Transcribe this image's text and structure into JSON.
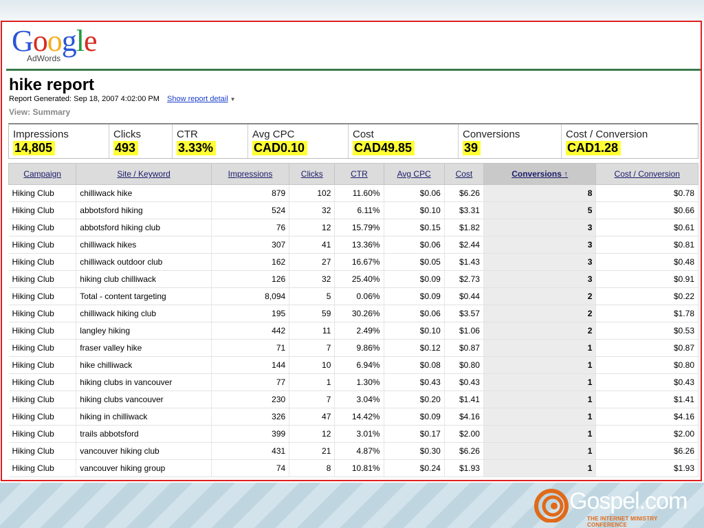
{
  "logo": {
    "letters": [
      "G",
      "o",
      "o",
      "g",
      "l",
      "e"
    ],
    "colors": [
      "#2a55d4",
      "#d62d20",
      "#f2b01e",
      "#2a55d4",
      "#1e9a3c",
      "#d62d20"
    ],
    "sub": "AdWords"
  },
  "report": {
    "title": "hike report",
    "generated": "Report Generated: Sep 18, 2007 4:02:00 PM",
    "detail_link": "Show report detail",
    "view": "View: Summary"
  },
  "stats": [
    {
      "label": "Impressions",
      "value": "14,805"
    },
    {
      "label": "Clicks",
      "value": "493"
    },
    {
      "label": "CTR",
      "value": "3.33%"
    },
    {
      "label": "Avg CPC",
      "value": "CAD0.10"
    },
    {
      "label": "Cost",
      "value": "CAD49.85"
    },
    {
      "label": "Conversions",
      "value": "39"
    },
    {
      "label": "Cost / Conversion",
      "value": "CAD1.28"
    }
  ],
  "table": {
    "headers": [
      "Campaign",
      "Site / Keyword",
      "Impressions",
      "Clicks",
      "CTR",
      "Avg CPC",
      "Cost",
      "Conversions ↑",
      "Cost / Conversion"
    ],
    "rows": [
      [
        "Hiking Club",
        "chilliwack hike",
        "879",
        "102",
        "11.60%",
        "$0.06",
        "$6.26",
        "8",
        "$0.78"
      ],
      [
        "Hiking Club",
        "abbotsford hiking",
        "524",
        "32",
        "6.11%",
        "$0.10",
        "$3.31",
        "5",
        "$0.66"
      ],
      [
        "Hiking Club",
        "abbotsford hiking club",
        "76",
        "12",
        "15.79%",
        "$0.15",
        "$1.82",
        "3",
        "$0.61"
      ],
      [
        "Hiking Club",
        "chilliwack hikes",
        "307",
        "41",
        "13.36%",
        "$0.06",
        "$2.44",
        "3",
        "$0.81"
      ],
      [
        "Hiking Club",
        "chilliwack outdoor club",
        "162",
        "27",
        "16.67%",
        "$0.05",
        "$1.43",
        "3",
        "$0.48"
      ],
      [
        "Hiking Club",
        "hiking club chilliwack",
        "126",
        "32",
        "25.40%",
        "$0.09",
        "$2.73",
        "3",
        "$0.91"
      ],
      [
        "Hiking Club",
        "Total - content targeting",
        "8,094",
        "5",
        "0.06%",
        "$0.09",
        "$0.44",
        "2",
        "$0.22"
      ],
      [
        "Hiking Club",
        "chilliwack hiking club",
        "195",
        "59",
        "30.26%",
        "$0.06",
        "$3.57",
        "2",
        "$1.78"
      ],
      [
        "Hiking Club",
        "langley hiking",
        "442",
        "11",
        "2.49%",
        "$0.10",
        "$1.06",
        "2",
        "$0.53"
      ],
      [
        "Hiking Club",
        "fraser valley hike",
        "71",
        "7",
        "9.86%",
        "$0.12",
        "$0.87",
        "1",
        "$0.87"
      ],
      [
        "Hiking Club",
        "hike chilliwack",
        "144",
        "10",
        "6.94%",
        "$0.08",
        "$0.80",
        "1",
        "$0.80"
      ],
      [
        "Hiking Club",
        "hiking clubs in vancouver",
        "77",
        "1",
        "1.30%",
        "$0.43",
        "$0.43",
        "1",
        "$0.43"
      ],
      [
        "Hiking Club",
        "hiking clubs vancouver",
        "230",
        "7",
        "3.04%",
        "$0.20",
        "$1.41",
        "1",
        "$1.41"
      ],
      [
        "Hiking Club",
        "hiking in chilliwack",
        "326",
        "47",
        "14.42%",
        "$0.09",
        "$4.16",
        "1",
        "$4.16"
      ],
      [
        "Hiking Club",
        "trails abbotsford",
        "399",
        "12",
        "3.01%",
        "$0.17",
        "$2.00",
        "1",
        "$2.00"
      ],
      [
        "Hiking Club",
        "vancouver hiking club",
        "431",
        "21",
        "4.87%",
        "$0.30",
        "$6.26",
        "1",
        "$6.26"
      ],
      [
        "Hiking Club",
        "vancouver hiking group",
        "74",
        "8",
        "10.81%",
        "$0.24",
        "$1.93",
        "1",
        "$1.93"
      ]
    ]
  },
  "footer": {
    "brand": "Gospel.com",
    "tagline": "THE INTERNET MINISTRY CONFERENCE",
    "accent": "#e06a1a"
  }
}
